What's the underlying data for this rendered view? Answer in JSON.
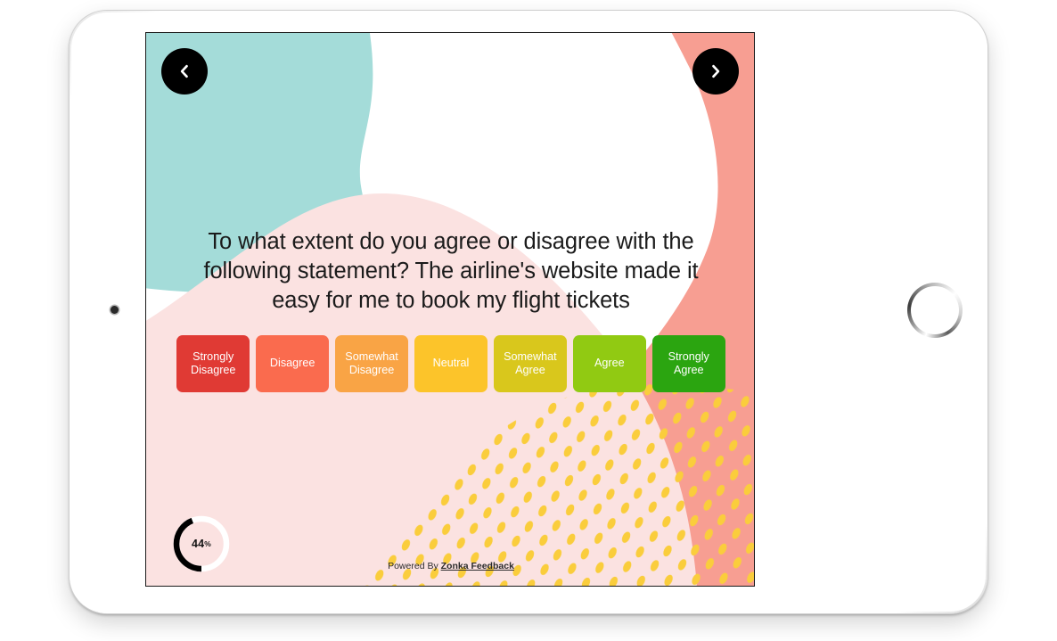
{
  "device": {
    "type": "tablet",
    "camera_icon": "camera-dot-icon",
    "home_button_icon": "home-button-ring-icon"
  },
  "survey": {
    "question": "To what extent do you agree or disagree with the following statement? The airline's website made it easy for me to book my flight tickets",
    "options": [
      {
        "label": "Strongly\nDisagree",
        "color": "#e03a34"
      },
      {
        "label": "Disagree",
        "color": "#fa6b4e"
      },
      {
        "label": "Somewhat\nDisagree",
        "color": "#f9a445"
      },
      {
        "label": "Neutral",
        "color": "#fcc42a"
      },
      {
        "label": "Somewhat\nAgree",
        "color": "#d9c71c"
      },
      {
        "label": "Agree",
        "color": "#91ca12"
      },
      {
        "label": "Strongly\nAgree",
        "color": "#2ba510"
      }
    ],
    "progress": {
      "value": 44,
      "display": "44",
      "unit": "%"
    },
    "navigation": {
      "previous_label": "Previous question",
      "previous_icon": "chevron-left-icon",
      "next_label": "Next question",
      "next_icon": "chevron-right-icon"
    },
    "footer": {
      "prefix": "Powered By ",
      "brand": "Zonka Feedback"
    }
  },
  "theme": {
    "background": "#ffffff",
    "blob_teal": "#a4dcd9",
    "blob_salmon": "#f79e92",
    "blob_pink": "#fbe2e1",
    "dot_yellow": "#facd3c",
    "text_dark": "#1b1b1b",
    "nav_button": "#000000"
  }
}
